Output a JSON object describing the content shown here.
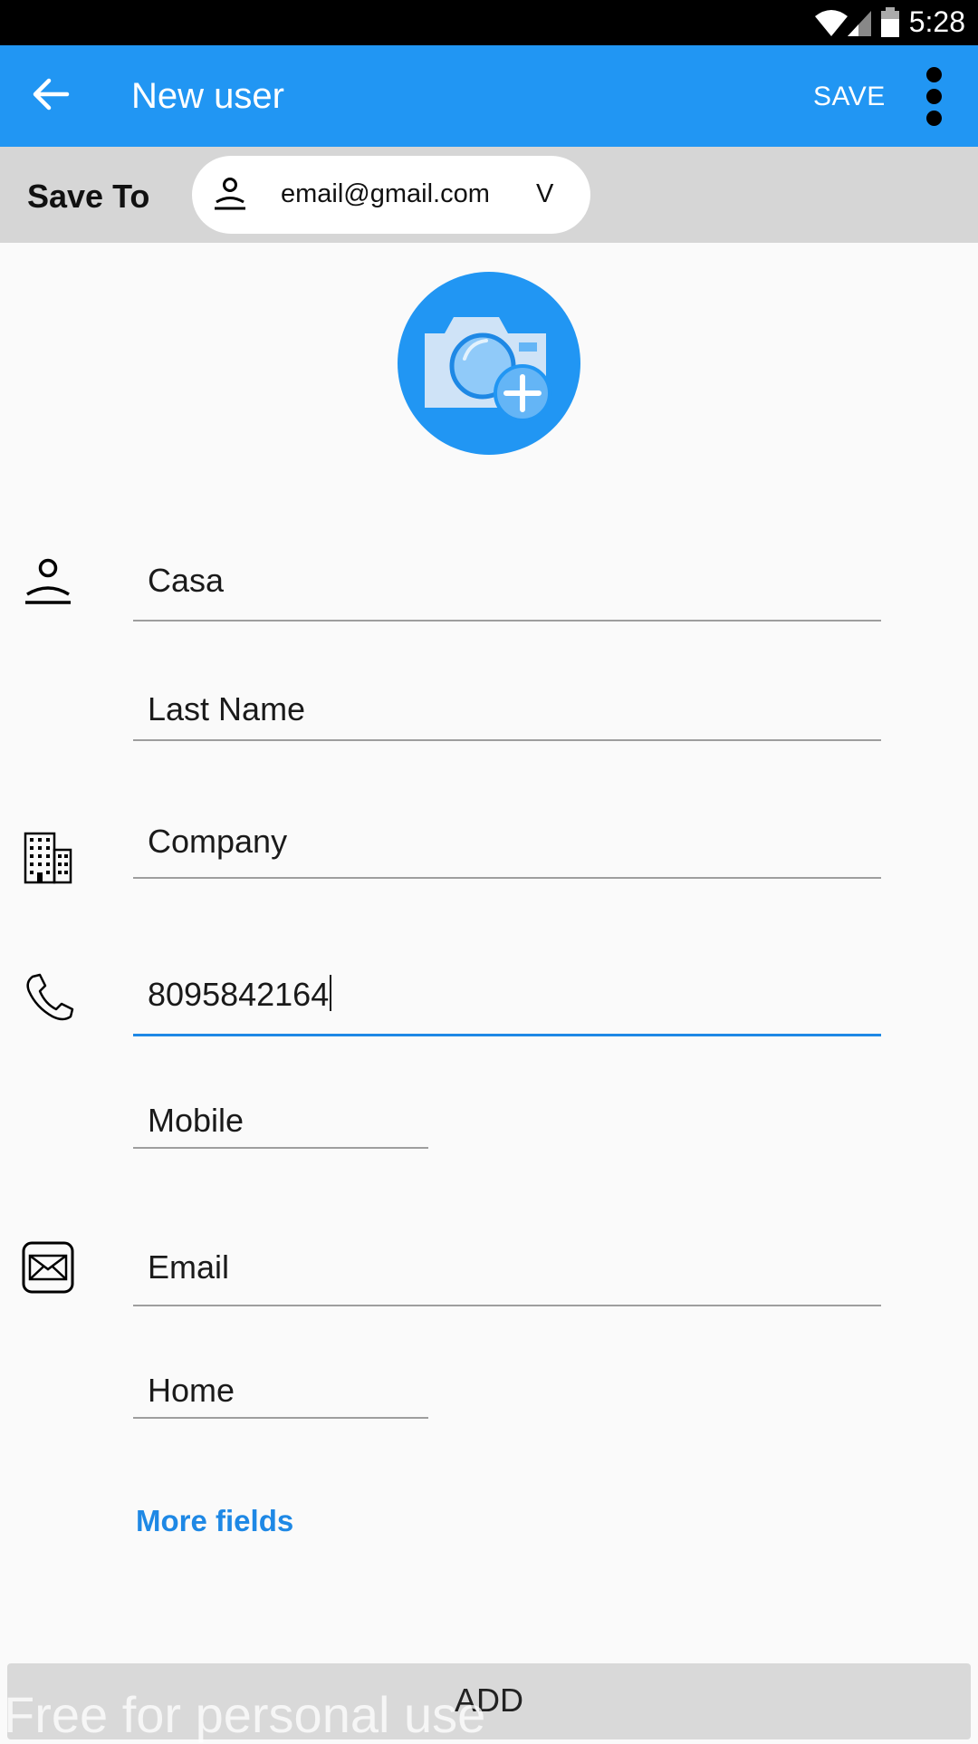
{
  "status_bar": {
    "time": "5:28",
    "icons": [
      "wifi-icon",
      "signal-icon",
      "battery-icon"
    ]
  },
  "app_bar": {
    "title": "New user",
    "back_icon": "arrow-left-icon",
    "save_label": "SAVE",
    "more_icon": "more-vertical-icon",
    "color": "#2196f3"
  },
  "save_to": {
    "label": "Save To",
    "account_icon": "person-icon",
    "account": "email@gmail.com",
    "chevron": "V"
  },
  "photo": {
    "icon": "add-photo-camera-icon"
  },
  "form": {
    "first_name": {
      "value": "Casa",
      "icon": "person-icon"
    },
    "last_name": {
      "placeholder": "Last Name"
    },
    "company": {
      "placeholder": "Company",
      "icon": "building-icon"
    },
    "phone": {
      "value": "8095842164",
      "icon": "phone-icon",
      "focused": true
    },
    "phone_type": {
      "value": "Mobile"
    },
    "email": {
      "placeholder": "Email",
      "icon": "envelope-icon"
    },
    "email_type": {
      "value": "Home"
    }
  },
  "more_fields_label": "More fields",
  "add_label": "ADD",
  "watermark": "Free for personal use",
  "colors": {
    "accent": "#1e88e5",
    "save_to_bar": "#d6d6d6",
    "add_button": "#d9d9d9"
  }
}
